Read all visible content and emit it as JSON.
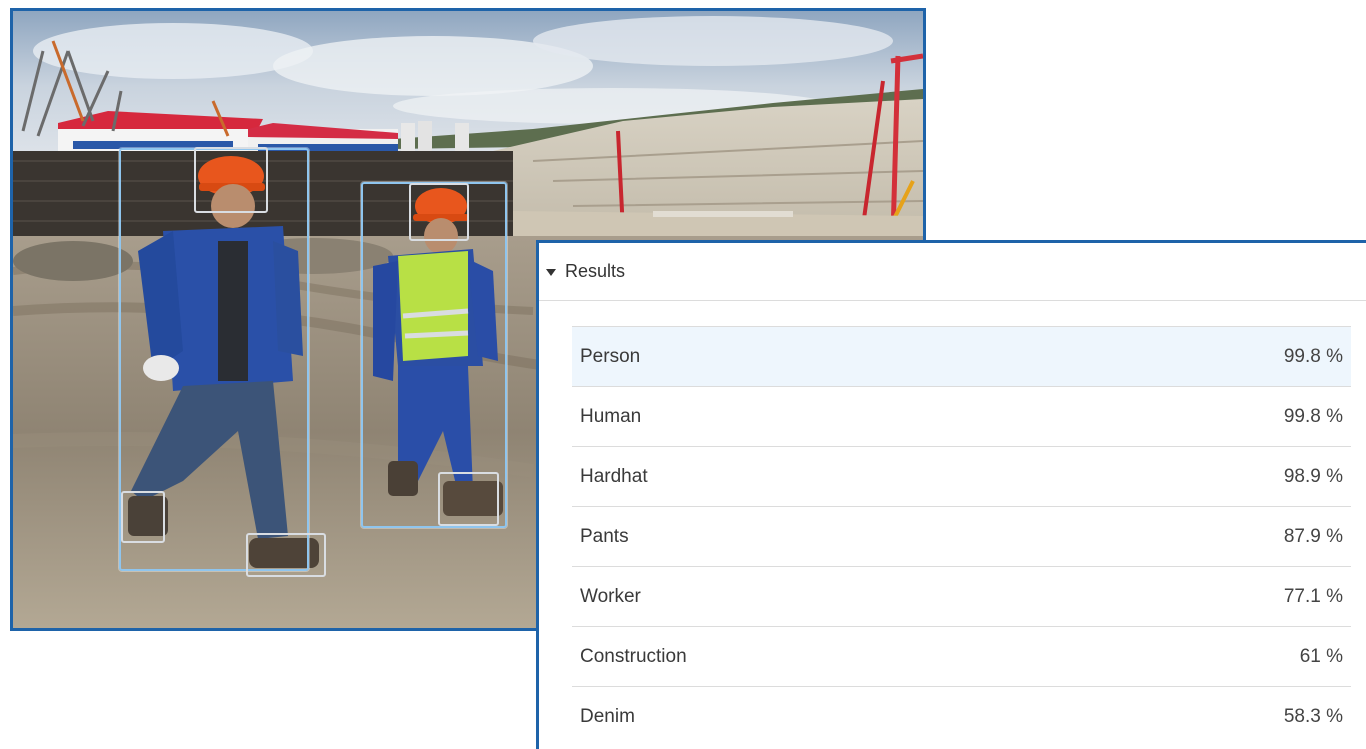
{
  "photo": {
    "description_icon": "construction-site-photo",
    "frame_color": "#1e63a9",
    "person_box_color": "#8fc5ee",
    "part_box_color": "#d9dde2"
  },
  "results": {
    "title": "Results",
    "expanded": true,
    "items": [
      {
        "label": "Person",
        "value": "99.8 %",
        "selected": true
      },
      {
        "label": "Human",
        "value": "99.8 %"
      },
      {
        "label": "Hardhat",
        "value": "98.9 %"
      },
      {
        "label": "Pants",
        "value": "87.9 %"
      },
      {
        "label": "Worker",
        "value": "77.1 %"
      },
      {
        "label": "Construction",
        "value": "61 %"
      },
      {
        "label": "Denim",
        "value": "58.3 %"
      }
    ]
  }
}
